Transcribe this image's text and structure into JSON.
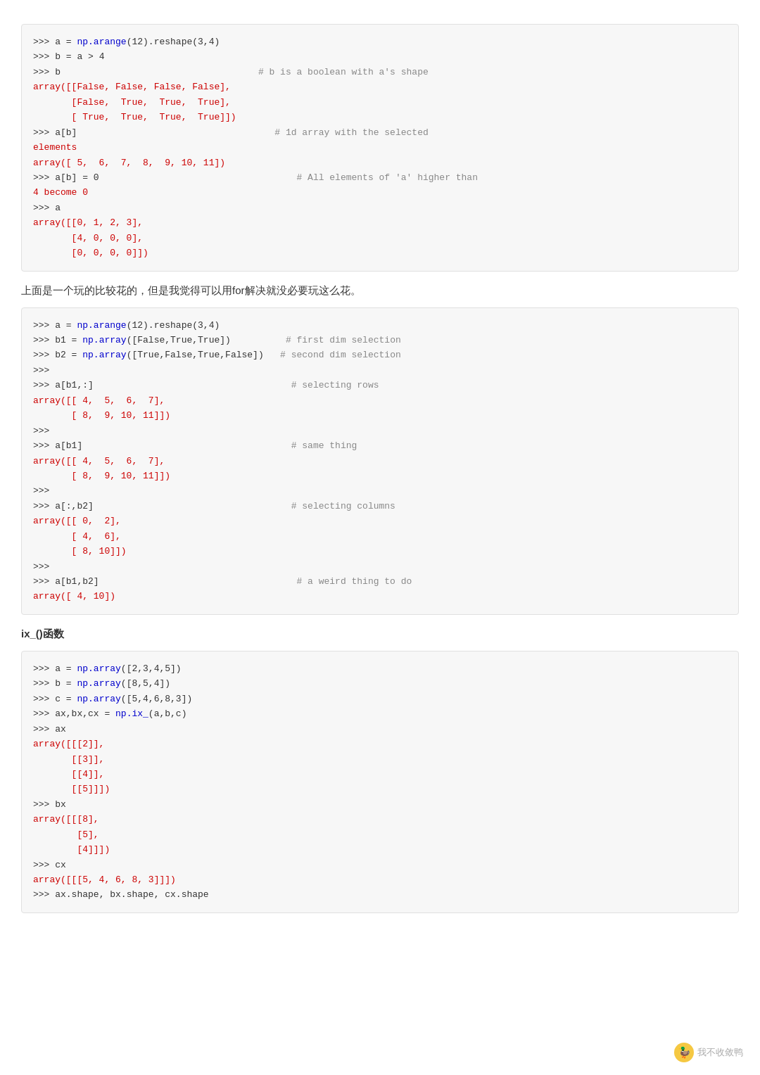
{
  "blocks": [
    {
      "id": "block1",
      "type": "code",
      "lines": [
        {
          "parts": [
            {
              "type": "prompt",
              "text": ">>> "
            },
            {
              "type": "code",
              "text": "a = np.arange(12).reshape(3,4)"
            }
          ]
        },
        {
          "parts": [
            {
              "type": "prompt",
              "text": ">>> "
            },
            {
              "type": "code",
              "text": "b = a > 4"
            }
          ]
        },
        {
          "parts": [
            {
              "type": "prompt",
              "text": ">>> "
            },
            {
              "type": "code",
              "text": "b"
            },
            {
              "type": "spacer",
              "text": "                                    "
            },
            {
              "type": "comment",
              "text": "# b is a boolean with a's shape"
            }
          ]
        },
        {
          "parts": [
            {
              "type": "result",
              "text": "array([[False, False, False, False],"
            }
          ]
        },
        {
          "parts": [
            {
              "type": "result",
              "text": "       [False,  True,  True,  True],"
            }
          ]
        },
        {
          "parts": [
            {
              "type": "result",
              "text": "       [ True,  True,  True,  True]])"
            }
          ]
        },
        {
          "parts": [
            {
              "type": "prompt",
              "text": ">>> "
            },
            {
              "type": "code",
              "text": "a[b]"
            },
            {
              "type": "spacer",
              "text": "                                    "
            },
            {
              "type": "comment",
              "text": "# 1d array with the selected"
            }
          ]
        },
        {
          "parts": [
            {
              "type": "result",
              "text": "elements"
            }
          ]
        },
        {
          "parts": [
            {
              "type": "result",
              "text": "array([ 5,  6,  7,  8,  9, 10, 11])"
            }
          ]
        },
        {
          "parts": [
            {
              "type": "prompt",
              "text": ">>> "
            },
            {
              "type": "code",
              "text": "a[b] = 0"
            },
            {
              "type": "spacer",
              "text": "                                    "
            },
            {
              "type": "comment",
              "text": "# All elements of 'a' higher than"
            }
          ]
        },
        {
          "parts": [
            {
              "type": "result",
              "text": "4 become 0"
            }
          ]
        },
        {
          "parts": [
            {
              "type": "prompt",
              "text": ">>> "
            },
            {
              "type": "code",
              "text": "a"
            }
          ]
        },
        {
          "parts": [
            {
              "type": "result",
              "text": "array([[0, 1, 2, 3],"
            }
          ]
        },
        {
          "parts": [
            {
              "type": "result",
              "text": "       [4, 0, 0, 0],"
            }
          ]
        },
        {
          "parts": [
            {
              "type": "result",
              "text": "       [0, 0, 0, 0]])"
            }
          ]
        }
      ]
    },
    {
      "id": "prose1",
      "type": "prose",
      "text": "上面是一个玩的比较花的，但是我觉得可以用for解决就没必要玩这么花。"
    },
    {
      "id": "block2",
      "type": "code",
      "lines": [
        {
          "parts": [
            {
              "type": "prompt",
              "text": ">>> "
            },
            {
              "type": "code",
              "text": "a = np.arange(12).reshape(3,4)"
            }
          ]
        },
        {
          "parts": [
            {
              "type": "prompt",
              "text": ">>> "
            },
            {
              "type": "code",
              "text": "b1 = np.array([False,True,True])"
            },
            {
              "type": "spacer",
              "text": "          "
            },
            {
              "type": "comment",
              "text": "# first dim selection"
            }
          ]
        },
        {
          "parts": [
            {
              "type": "prompt",
              "text": ">>> "
            },
            {
              "type": "code",
              "text": "b2 = np.array([True,False,True,False])"
            },
            {
              "type": "spacer",
              "text": "   "
            },
            {
              "type": "comment",
              "text": "# second dim selection"
            }
          ]
        },
        {
          "parts": [
            {
              "type": "prompt",
              "text": ">>> "
            }
          ]
        },
        {
          "parts": [
            {
              "type": "prompt",
              "text": ">>> "
            },
            {
              "type": "code",
              "text": "a[b1,:]"
            },
            {
              "type": "spacer",
              "text": "                                    "
            },
            {
              "type": "comment",
              "text": "# selecting rows"
            }
          ]
        },
        {
          "parts": [
            {
              "type": "result",
              "text": "array([[ 4,  5,  6,  7],"
            }
          ]
        },
        {
          "parts": [
            {
              "type": "result",
              "text": "       [ 8,  9, 10, 11]])"
            }
          ]
        },
        {
          "parts": [
            {
              "type": "prompt",
              "text": ">>> "
            }
          ]
        },
        {
          "parts": [
            {
              "type": "prompt",
              "text": ">>> "
            },
            {
              "type": "code",
              "text": "a[b1]"
            },
            {
              "type": "spacer",
              "text": "                                      "
            },
            {
              "type": "comment",
              "text": "# same thing"
            }
          ]
        },
        {
          "parts": [
            {
              "type": "result",
              "text": "array([[ 4,  5,  6,  7],"
            }
          ]
        },
        {
          "parts": [
            {
              "type": "result",
              "text": "       [ 8,  9, 10, 11]])"
            }
          ]
        },
        {
          "parts": [
            {
              "type": "prompt",
              "text": ">>> "
            }
          ]
        },
        {
          "parts": [
            {
              "type": "prompt",
              "text": ">>> "
            },
            {
              "type": "code",
              "text": "a[:,b2]"
            },
            {
              "type": "spacer",
              "text": "                                    "
            },
            {
              "type": "comment",
              "text": "# selecting columns"
            }
          ]
        },
        {
          "parts": [
            {
              "type": "result",
              "text": "array([[ 0,  2],"
            }
          ]
        },
        {
          "parts": [
            {
              "type": "result",
              "text": "       [ 4,  6],"
            }
          ]
        },
        {
          "parts": [
            {
              "type": "result",
              "text": "       [ 8, 10]])"
            }
          ]
        },
        {
          "parts": [
            {
              "type": "prompt",
              "text": ">>> "
            }
          ]
        },
        {
          "parts": [
            {
              "type": "prompt",
              "text": ">>> "
            },
            {
              "type": "code",
              "text": "a[b1,b2]"
            },
            {
              "type": "spacer",
              "text": "                                    "
            },
            {
              "type": "comment",
              "text": "# a weird thing to do"
            }
          ]
        },
        {
          "parts": [
            {
              "type": "result",
              "text": "array([ 4, 10])"
            }
          ]
        }
      ]
    },
    {
      "id": "section1",
      "type": "section-title",
      "text": "ix_()函数"
    },
    {
      "id": "block3",
      "type": "code",
      "lines": [
        {
          "parts": [
            {
              "type": "prompt",
              "text": ">>> "
            },
            {
              "type": "code",
              "text": "a = np.array([2,3,4,5])"
            }
          ]
        },
        {
          "parts": [
            {
              "type": "prompt",
              "text": ">>> "
            },
            {
              "type": "code",
              "text": "b = np.array([8,5,4])"
            }
          ]
        },
        {
          "parts": [
            {
              "type": "prompt",
              "text": ">>> "
            },
            {
              "type": "code",
              "text": "c = np.array([5,4,6,8,3])"
            }
          ]
        },
        {
          "parts": [
            {
              "type": "prompt",
              "text": ">>> "
            },
            {
              "type": "code",
              "text": "ax,bx,cx = np.ix_(a,b,c)"
            }
          ]
        },
        {
          "parts": [
            {
              "type": "prompt",
              "text": ">>> "
            },
            {
              "type": "code",
              "text": "ax"
            }
          ]
        },
        {
          "parts": [
            {
              "type": "result",
              "text": "array([[[2]],"
            }
          ]
        },
        {
          "parts": [
            {
              "type": "result",
              "text": "       [[3]],"
            }
          ]
        },
        {
          "parts": [
            {
              "type": "result",
              "text": "       [[4]],"
            }
          ]
        },
        {
          "parts": [
            {
              "type": "result",
              "text": "       [[5]]])"
            }
          ]
        },
        {
          "parts": [
            {
              "type": "prompt",
              "text": ">>> "
            },
            {
              "type": "code",
              "text": "bx"
            }
          ]
        },
        {
          "parts": [
            {
              "type": "result",
              "text": "array([[[8],"
            }
          ]
        },
        {
          "parts": [
            {
              "type": "result",
              "text": "        [5],"
            }
          ]
        },
        {
          "parts": [
            {
              "type": "result",
              "text": "        [4]]])"
            }
          ]
        },
        {
          "parts": [
            {
              "type": "prompt",
              "text": ">>> "
            },
            {
              "type": "code",
              "text": "cx"
            }
          ]
        },
        {
          "parts": [
            {
              "type": "result",
              "text": "array([[[5, 4, 6, 8, 3]]])"
            }
          ]
        },
        {
          "parts": [
            {
              "type": "prompt",
              "text": ">>> "
            },
            {
              "type": "code",
              "text": "ax.shape, bx.shape, cx.shape"
            }
          ]
        }
      ]
    }
  ],
  "watermark": {
    "icon": "🦆",
    "text": "我不收敛鸭"
  }
}
